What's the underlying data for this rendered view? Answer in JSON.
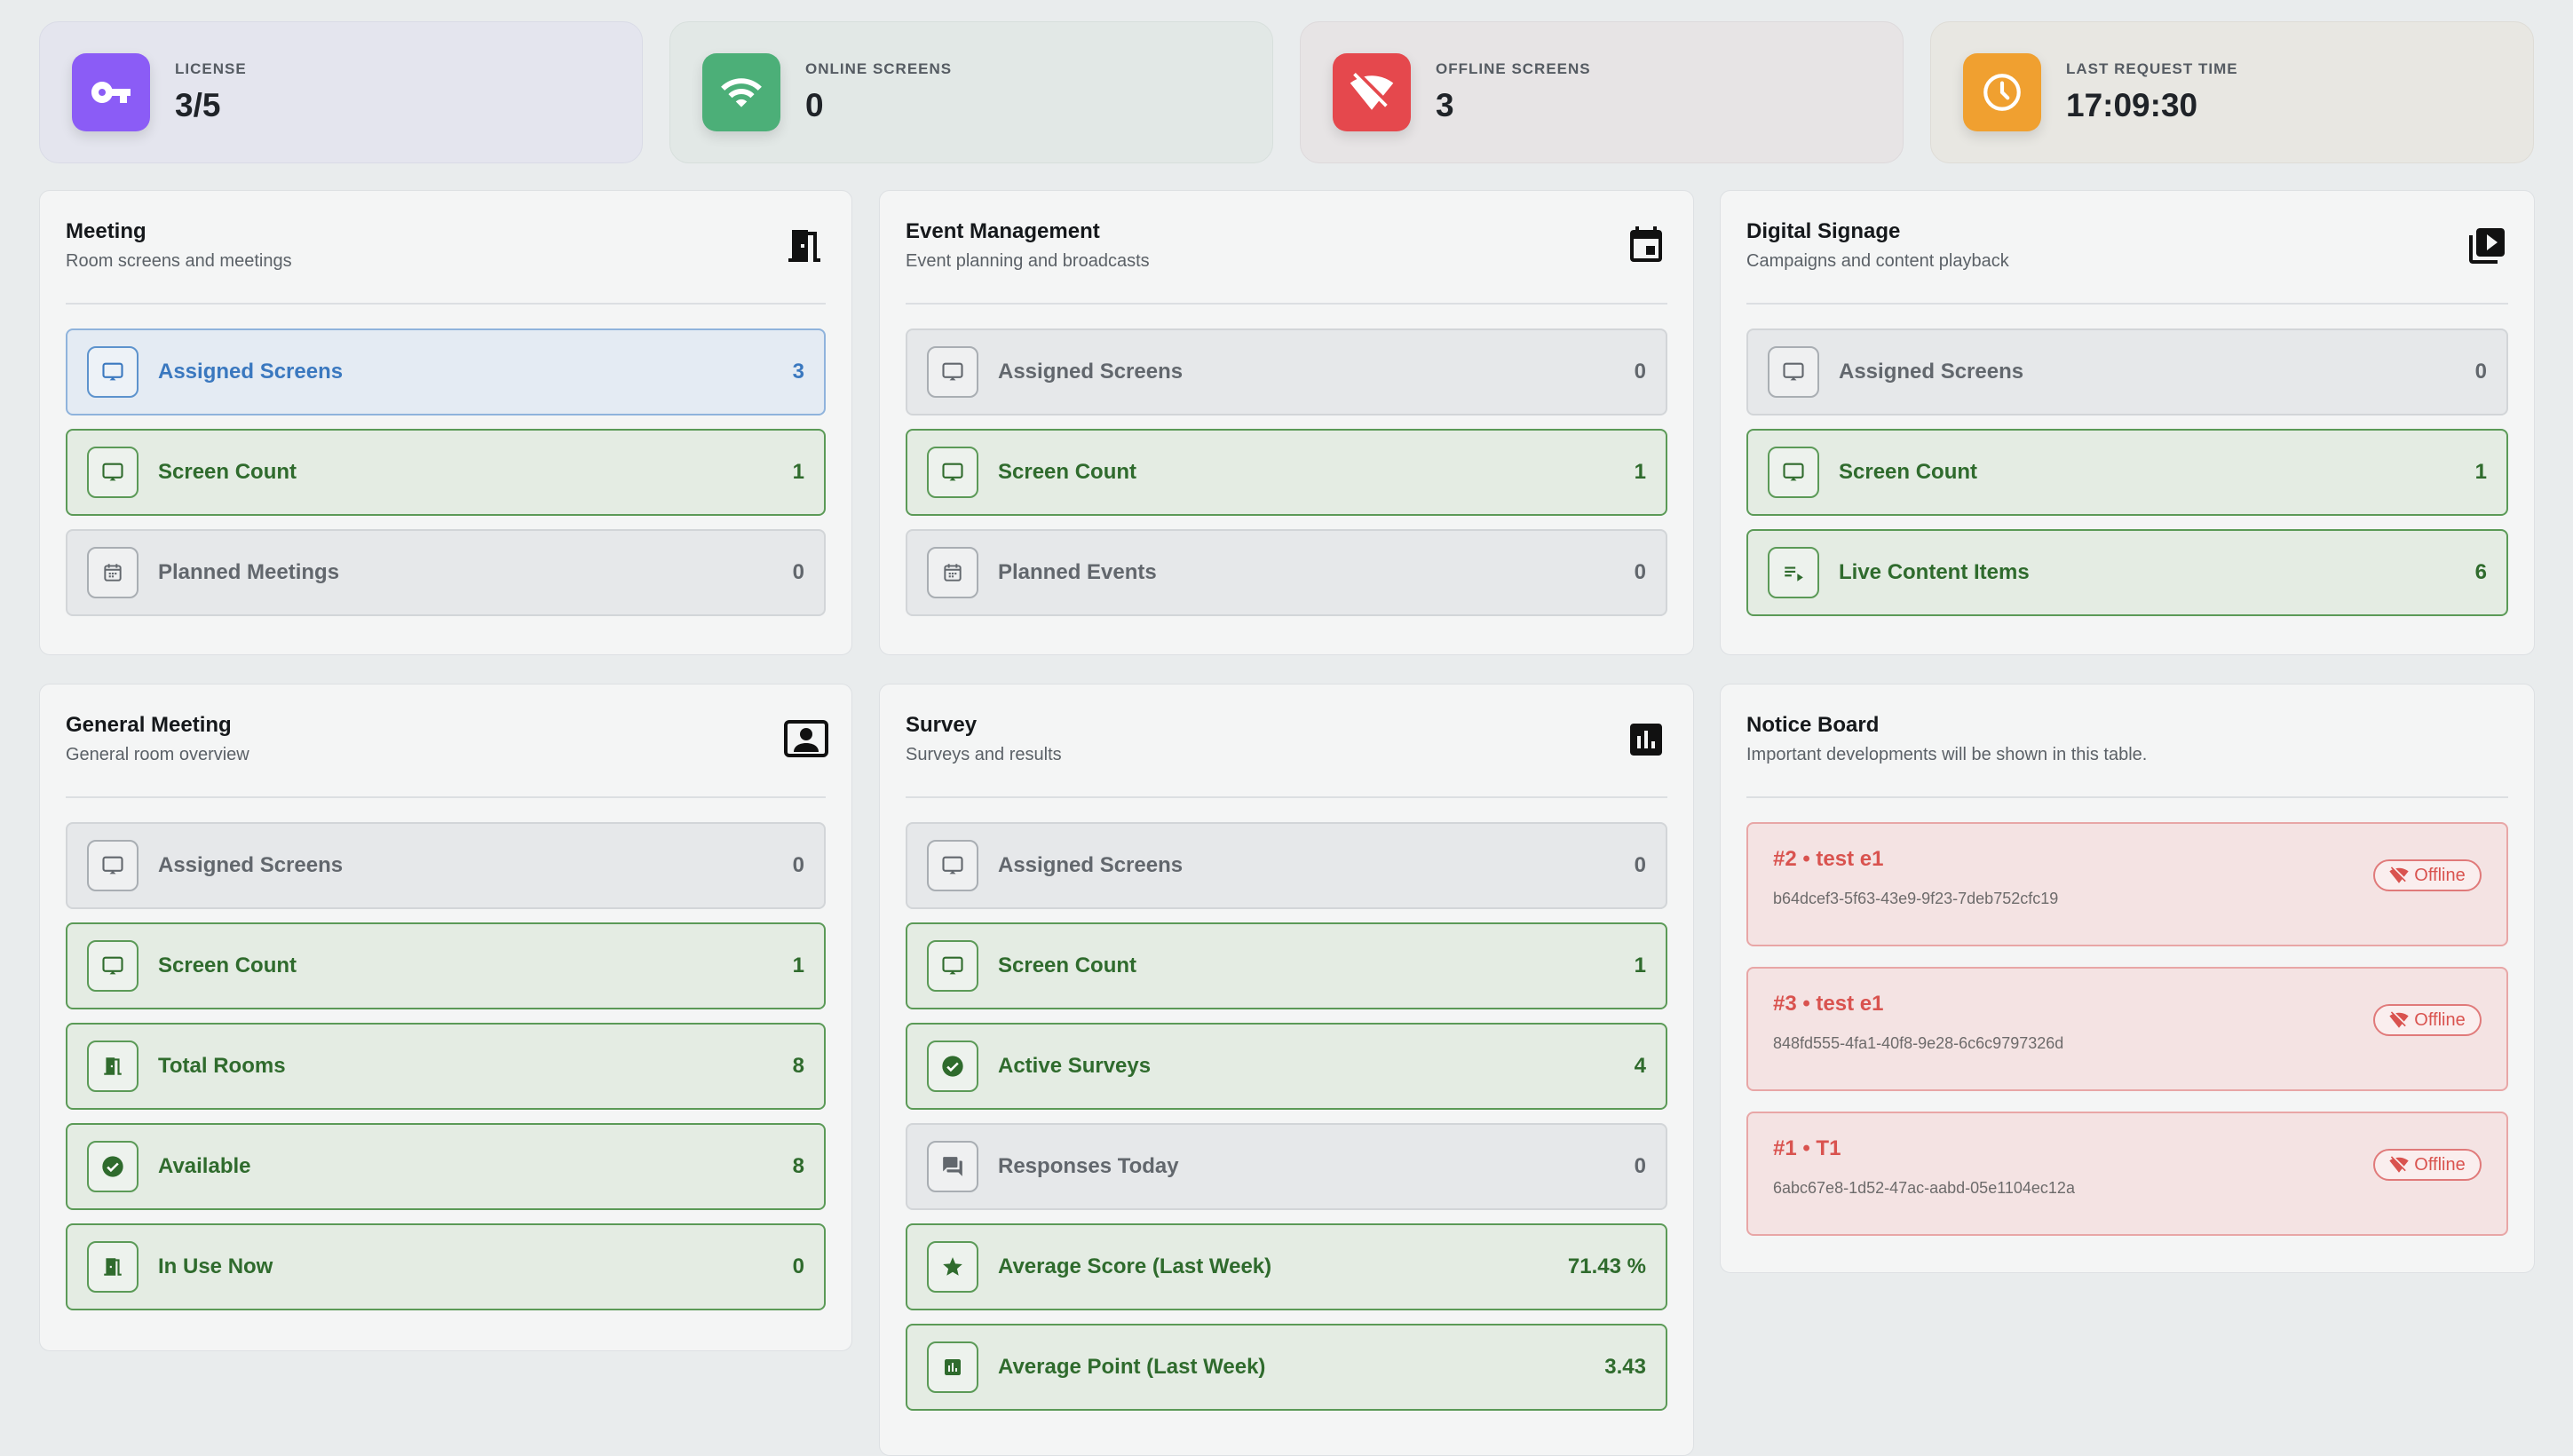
{
  "stats": [
    {
      "label": "LICENSE",
      "value": "3/5",
      "icon": "key-icon",
      "color": "#8b5cf6"
    },
    {
      "label": "ONLINE SCREENS",
      "value": "0",
      "icon": "wifi-icon",
      "color": "#4caf78"
    },
    {
      "label": "OFFLINE SCREENS",
      "value": "3",
      "icon": "wifi-off-icon",
      "color": "#e5484d"
    },
    {
      "label": "LAST REQUEST TIME",
      "value": "17:09:30",
      "icon": "clock-icon",
      "color": "#f0a030"
    }
  ],
  "meeting": {
    "title": "Meeting",
    "subtitle": "Room screens and meetings",
    "icon": "door-icon",
    "rows": [
      {
        "label": "Assigned Screens",
        "value": "3",
        "icon": "cast-icon",
        "style": "blue"
      },
      {
        "label": "Screen Count",
        "value": "1",
        "icon": "cast-icon",
        "style": "green"
      },
      {
        "label": "Planned Meetings",
        "value": "0",
        "icon": "calendar-icon",
        "style": "gray"
      }
    ]
  },
  "event": {
    "title": "Event Management",
    "subtitle": "Event planning and broadcasts",
    "icon": "event-icon",
    "rows": [
      {
        "label": "Assigned Screens",
        "value": "0",
        "icon": "cast-icon",
        "style": "gray"
      },
      {
        "label": "Screen Count",
        "value": "1",
        "icon": "cast-icon",
        "style": "green"
      },
      {
        "label": "Planned Events",
        "value": "0",
        "icon": "calendar-icon",
        "style": "gray"
      }
    ]
  },
  "signage": {
    "title": "Digital Signage",
    "subtitle": "Campaigns and content playback",
    "icon": "video-library-icon",
    "rows": [
      {
        "label": "Assigned Screens",
        "value": "0",
        "icon": "cast-icon",
        "style": "gray"
      },
      {
        "label": "Screen Count",
        "value": "1",
        "icon": "cast-icon",
        "style": "green"
      },
      {
        "label": "Live Content Items",
        "value": "6",
        "icon": "playlist-icon",
        "style": "green"
      }
    ]
  },
  "general": {
    "title": "General Meeting",
    "subtitle": "General room overview",
    "icon": "contact-icon",
    "rows": [
      {
        "label": "Assigned Screens",
        "value": "0",
        "icon": "cast-icon",
        "style": "gray"
      },
      {
        "label": "Screen Count",
        "value": "1",
        "icon": "cast-icon",
        "style": "green"
      },
      {
        "label": "Total Rooms",
        "value": "8",
        "icon": "door-icon",
        "style": "green"
      },
      {
        "label": "Available",
        "value": "8",
        "icon": "check-circle-icon",
        "style": "green"
      },
      {
        "label": "In Use Now",
        "value": "0",
        "icon": "door-open-icon",
        "style": "green"
      }
    ]
  },
  "survey": {
    "title": "Survey",
    "subtitle": "Surveys and results",
    "icon": "bar-chart-icon",
    "rows": [
      {
        "label": "Assigned Screens",
        "value": "0",
        "icon": "cast-icon",
        "style": "gray"
      },
      {
        "label": "Screen Count",
        "value": "1",
        "icon": "cast-icon",
        "style": "green"
      },
      {
        "label": "Active Surveys",
        "value": "4",
        "icon": "check-circle-icon",
        "style": "green"
      },
      {
        "label": "Responses Today",
        "value": "0",
        "icon": "forum-icon",
        "style": "gray"
      },
      {
        "label": "Average Score (Last Week)",
        "value": "71.43 %",
        "icon": "star-icon",
        "style": "green"
      },
      {
        "label": "Average Point (Last Week)",
        "value": "3.43",
        "icon": "bar-chart-icon",
        "style": "green"
      }
    ]
  },
  "notice": {
    "title": "Notice Board",
    "subtitle": "Important developments will be shown in this table.",
    "items": [
      {
        "title": "#2 • test e1",
        "id": "b64dcef3-5f63-43e9-9f23-7deb752cfc19",
        "badge": "Offline"
      },
      {
        "title": "#3 • test e1",
        "id": "848fd555-4fa1-40f8-9e28-6c6c9797326d",
        "badge": "Offline"
      },
      {
        "title": "#1 • T1",
        "id": "6abc67e8-1d52-47ac-aabd-05e1104ec12a",
        "badge": "Offline"
      }
    ]
  }
}
